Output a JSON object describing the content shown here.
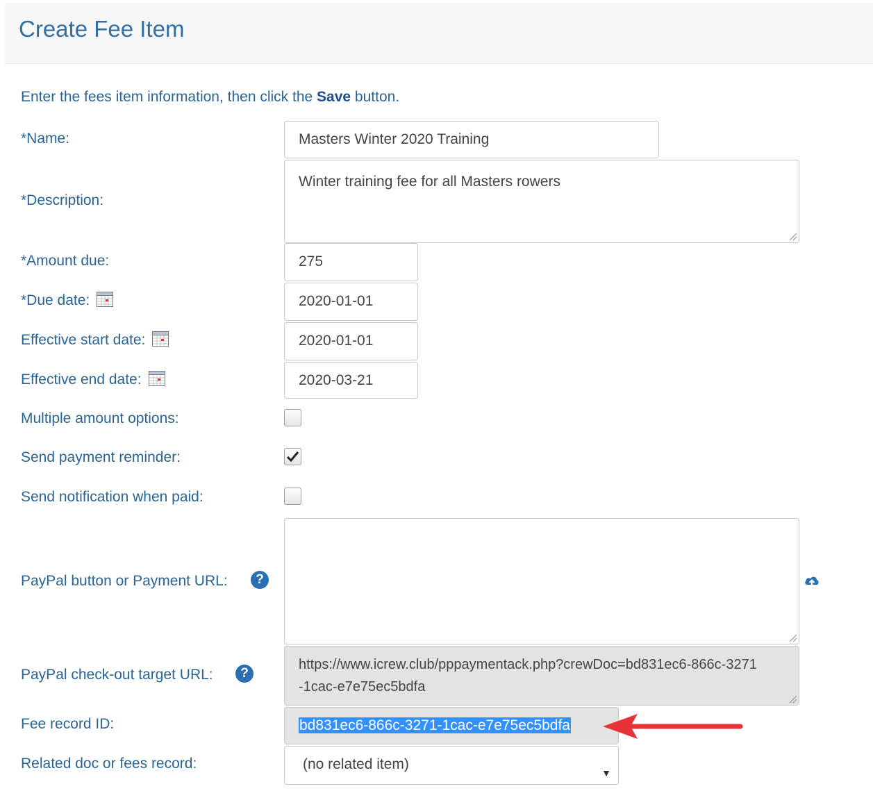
{
  "page": {
    "title": "Create Fee Item"
  },
  "intro": {
    "prefix": "Enter the fees item information, then click the ",
    "emphasis": "Save",
    "suffix": " button."
  },
  "fields": {
    "name": {
      "label": "*Name:",
      "value": "Masters Winter 2020 Training"
    },
    "description": {
      "label": "*Description:",
      "value": "Winter training fee for all Masters rowers"
    },
    "amount_due": {
      "label": "*Amount due:",
      "value": "275"
    },
    "due_date": {
      "label": "*Due date:",
      "value": "2020-01-01"
    },
    "effective_start": {
      "label": "Effective start date:",
      "value": "2020-01-01"
    },
    "effective_end": {
      "label": "Effective end date:",
      "value": "2020-03-21"
    },
    "multiple_amounts": {
      "label": "Multiple amount options:",
      "checked": false
    },
    "payment_reminder": {
      "label": "Send payment reminder:",
      "checked": true
    },
    "notification_paid": {
      "label": "Send notification when paid:",
      "checked": false
    },
    "paypal_button": {
      "label": "PayPal button or Payment URL:",
      "value": ""
    },
    "paypal_target": {
      "label": "PayPal check-out target URL:",
      "value": "https://www.icrew.club/pppaymentack.php?crewDoc=bd831ec6-866c-3271-1cac-e7e75ec5bdfa"
    },
    "fee_record_id": {
      "label": "Fee record ID:",
      "value": "bd831ec6-866c-3271-1cac-e7e75ec5bdfa"
    },
    "related_doc": {
      "label": "Related doc or fees record:",
      "value": "(no related item)"
    }
  },
  "icons": {
    "calendar": "calendar-icon",
    "help": "question-circle-icon",
    "upload": "cloud-upload-icon",
    "annotation": "red-arrow"
  },
  "colors": {
    "label": "#2a6496",
    "title": "#2f6fa6",
    "help": "#2a6fb4",
    "selection": "#3390ff",
    "arrow": "#e8323a"
  }
}
